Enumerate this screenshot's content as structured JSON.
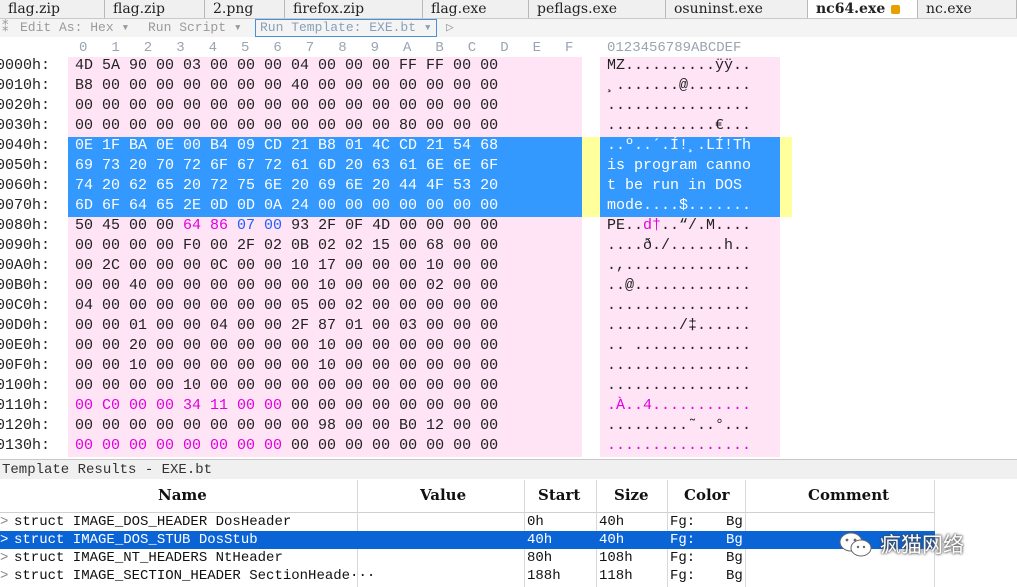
{
  "tabs": [
    {
      "label": "flag.zip"
    },
    {
      "label": "flag.zip"
    },
    {
      "label": "2.png"
    },
    {
      "label": "firefox.zip"
    },
    {
      "label": "flag.exe"
    },
    {
      "label": "peflags.exe"
    },
    {
      "label": "osuninst.exe"
    },
    {
      "label": "nc64.exe",
      "active": true
    },
    {
      "label": "nc.exe"
    }
  ],
  "toolbar": {
    "edit_as": "Edit As: Hex",
    "edit_as_arrow": "▾",
    "run_script": "Run Script",
    "run_script_arrow": "▾",
    "run_template": "Run Template: EXE.bt",
    "run_template_arrow": "▾",
    "play_arrow": "▷"
  },
  "hex_header": {
    "columns": [
      "0",
      "1",
      "2",
      "3",
      "4",
      "5",
      "6",
      "7",
      "8",
      "9",
      "A",
      "B",
      "C",
      "D",
      "E",
      "F"
    ],
    "ascii_header": "0123456789ABCDEF"
  },
  "hex_rows": [
    {
      "addr": "0000h:",
      "bytes": "4D 5A 90 00 03 00 00 00 04 00 00 00 FF FF 00 00",
      "ascii": "MZ..........ÿÿ.."
    },
    {
      "addr": "0010h:",
      "bytes": "B8 00 00 00 00 00 00 00 40 00 00 00 00 00 00 00",
      "ascii": "¸.......@......."
    },
    {
      "addr": "0020h:",
      "bytes": "00 00 00 00 00 00 00 00 00 00 00 00 00 00 00 00",
      "ascii": "................"
    },
    {
      "addr": "0030h:",
      "bytes": "00 00 00 00 00 00 00 00 00 00 00 00 80 00 00 00",
      "ascii": "............€..."
    },
    {
      "addr": "0040h:",
      "bytes": "0E 1F BA 0E 00 B4 09 CD 21 B8 01 4C CD 21 54 68",
      "ascii": "..º..´.Í!¸.LÍ!Th"
    },
    {
      "addr": "0050h:",
      "bytes": "69 73 20 70 72 6F 67 72 61 6D 20 63 61 6E 6E 6F",
      "ascii": "is program canno"
    },
    {
      "addr": "0060h:",
      "bytes": "74 20 62 65 20 72 75 6E 20 69 6E 20 44 4F 53 20",
      "ascii": "t be run in DOS "
    },
    {
      "addr": "0070h:",
      "bytes": "6D 6F 64 65 2E 0D 0D 0A 24 00 00 00 00 00 00 00",
      "ascii": "mode....$......."
    },
    {
      "addr": "0080h:",
      "bytes_a": "50 45 00 00 ",
      "bytes_m": "64 86 ",
      "bytes_b": "07 00",
      "bytes_c": " 93 2F 0F 4D 00 00 00 00",
      "ascii_a": "PE..",
      "ascii_m": "d†",
      "ascii_b": "..“/.M...."
    },
    {
      "addr": "0090h:",
      "bytes": "00 00 00 00 F0 00 2F 02 0B 02 02 15 00 68 00 00",
      "ascii": "....ð./......h.."
    },
    {
      "addr": "00A0h:",
      "bytes": "00 2C 00 00 00 0C 00 00 10 17 00 00 00 10 00 00",
      "ascii": ".,.............."
    },
    {
      "addr": "00B0h:",
      "bytes": "00 00 40 00 00 00 00 00 00 10 00 00 00 02 00 00",
      "ascii": "..@............."
    },
    {
      "addr": "00C0h:",
      "bytes": "04 00 00 00 00 00 00 00 05 00 02 00 00 00 00 00",
      "ascii": "................"
    },
    {
      "addr": "00D0h:",
      "bytes": "00 00 01 00 00 04 00 00 2F 87 01 00 03 00 00 00",
      "ascii": "......../‡......"
    },
    {
      "addr": "00E0h:",
      "bytes": "00 00 20 00 00 00 00 00 00 10 00 00 00 00 00 00",
      "ascii": ".. ............."
    },
    {
      "addr": "00F0h:",
      "bytes": "00 00 10 00 00 00 00 00 00 10 00 00 00 00 00 00",
      "ascii": "................"
    },
    {
      "addr": "0100h:",
      "bytes": "00 00 00 00 10 00 00 00 00 00 00 00 00 00 00 00",
      "ascii": "................"
    },
    {
      "addr": "0110h:",
      "bytes_m": "00 C0 00 00 34 11 00 00",
      "bytes_c": " 00 00 00 00 00 00 00 00",
      "ascii_m": ".À..4...",
      "ascii_b": "........"
    },
    {
      "addr": "0120h:",
      "bytes": "00 00 00 00 00 00 00 00 00 98 00 00 B0 12 00 00",
      "ascii": ".........˜..°..."
    },
    {
      "addr": "0130h:",
      "bytes_m": "00 00 00 00 00 00 00 00",
      "bytes_c": " 00 00 00 00 00 00 00 00",
      "ascii_m": "........",
      "ascii_b": "........"
    }
  ],
  "template_results": {
    "title": "Template Results - EXE.bt",
    "headers": {
      "name": "Name",
      "value": "Value",
      "start": "Start",
      "size": "Size",
      "color": "Color",
      "comment": "Comment"
    },
    "rows": [
      {
        "name": "struct IMAGE_DOS_HEADER DosHeader",
        "value": "",
        "start": "0h",
        "size": "40h",
        "fg": "Fg:",
        "bg": "Bg"
      },
      {
        "name": "struct IMAGE_DOS_STUB DosStub",
        "value": "",
        "start": "40h",
        "size": "40h",
        "fg": "Fg:",
        "bg": "Bg",
        "selected": true
      },
      {
        "name": "struct IMAGE_NT_HEADERS NtHeader",
        "value": "",
        "start": "80h",
        "size": "108h",
        "fg": "Fg:",
        "bg": "Bg"
      },
      {
        "name": "struct IMAGE_SECTION_HEADER SectionHeade···",
        "value": "",
        "start": "188h",
        "size": "118h",
        "fg": "Fg:",
        "bg": "Bg"
      }
    ]
  },
  "watermark": {
    "text": "疯猫网络",
    "icon": "wechat-icon"
  },
  "colors": {
    "selection": "#3399ff",
    "highlight_row": "#0a64d6",
    "pink": "#ffe4f6",
    "magenta": "#e000e0",
    "yellow": "#ffff9c"
  }
}
